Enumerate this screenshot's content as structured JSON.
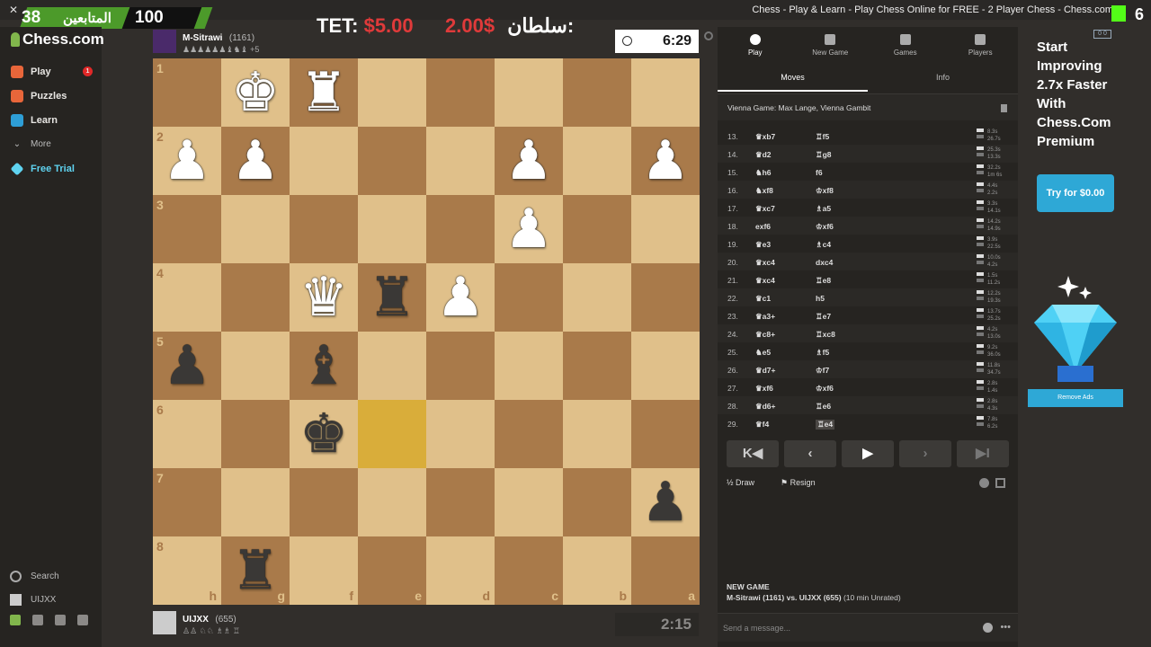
{
  "window": {
    "title": "Chess - Play & Learn - Play Chess Online for FREE - 2 Player Chess - Chess.com"
  },
  "overlay": {
    "count_left": "38",
    "label": "المتابعين",
    "count_right": "100",
    "kick_count": "6",
    "kick_mini": "0 0"
  },
  "donations": {
    "first_name": "TET:",
    "first_amount": "$5.00",
    "second_amount": "2.00$",
    "second_name": "سلطان:"
  },
  "sidebar": {
    "logo": "Chess.com",
    "items": [
      {
        "label": "Play",
        "badge": "1",
        "color": "#e8663a"
      },
      {
        "label": "Puzzles",
        "color": "#e8663a"
      },
      {
        "label": "Learn",
        "color": "#2e9ed6"
      },
      {
        "label": "More"
      },
      {
        "label": "Free Trial",
        "color": "#5fd3f0"
      }
    ],
    "search_label": "Search",
    "user_label": "UIJXX"
  },
  "top_player": {
    "name": "M-Sitrawi",
    "rating": "(1161)",
    "captured": "♟♟♟♟♟♟♝♞♝ +5",
    "clock": "6:29"
  },
  "bottom_player": {
    "name": "UIJXX",
    "rating": "(655)",
    "captured": "♙♙ ♘♘ ♗♗ ♖",
    "clock": "2:15"
  },
  "board": {
    "orientation": "black",
    "ranks": [
      "1",
      "2",
      "3",
      "4",
      "5",
      "6",
      "7",
      "8"
    ],
    "files": [
      "h",
      "g",
      "f",
      "e",
      "d",
      "c",
      "b",
      "a"
    ],
    "highlight": [
      "e6"
    ],
    "pieces": [
      {
        "sq": "g1",
        "type": "K",
        "color": "w"
      },
      {
        "sq": "f1",
        "type": "R",
        "color": "w"
      },
      {
        "sq": "h2",
        "type": "P",
        "color": "w"
      },
      {
        "sq": "g2",
        "type": "P",
        "color": "w"
      },
      {
        "sq": "c2",
        "type": "P",
        "color": "w"
      },
      {
        "sq": "a2",
        "type": "P",
        "color": "w"
      },
      {
        "sq": "c3",
        "type": "P",
        "color": "w"
      },
      {
        "sq": "f4",
        "type": "Q",
        "color": "w"
      },
      {
        "sq": "e4",
        "type": "R",
        "color": "b"
      },
      {
        "sq": "d4",
        "type": "P",
        "color": "w"
      },
      {
        "sq": "h5",
        "type": "P",
        "color": "b"
      },
      {
        "sq": "f5",
        "type": "B",
        "color": "b"
      },
      {
        "sq": "f6",
        "type": "K",
        "color": "b"
      },
      {
        "sq": "a7",
        "type": "P",
        "color": "b"
      },
      {
        "sq": "g8",
        "type": "R",
        "color": "b"
      }
    ]
  },
  "panel": {
    "tabs": [
      "Play",
      "New Game",
      "Games",
      "Players"
    ],
    "subtabs": [
      "Moves",
      "Info"
    ],
    "opening": "Vienna Game: Max Lange, Vienna Gambit",
    "moves": [
      {
        "n": "13.",
        "w": "♛xb7",
        "b": "♖f5",
        "t1": "8.3s",
        "t2": "26.7s"
      },
      {
        "n": "14.",
        "w": "♛d2",
        "b": "♖g8",
        "t1": "25.3s",
        "t2": "13.3s"
      },
      {
        "n": "15.",
        "w": "♞h6",
        "b": "f6",
        "t1": "32.2s",
        "t2": "1m 6s"
      },
      {
        "n": "16.",
        "w": "♞xf8",
        "b": "♔xf8",
        "t1": "4.4s",
        "t2": "2.2s"
      },
      {
        "n": "17.",
        "w": "♛xc7",
        "b": "♗a5",
        "t1": "3.3s",
        "t2": "14.1s"
      },
      {
        "n": "18.",
        "w": "exf6",
        "b": "♔xf6",
        "t1": "14.2s",
        "t2": "14.9s"
      },
      {
        "n": "19.",
        "w": "♛e3",
        "b": "♗c4",
        "t1": "3.9s",
        "t2": "22.5s"
      },
      {
        "n": "20.",
        "w": "♛xc4",
        "b": "dxc4",
        "t1": "10.0s",
        "t2": "4.2s"
      },
      {
        "n": "21.",
        "w": "♛xc4",
        "b": "♖e8",
        "t1": "1.5s",
        "t2": "11.2s"
      },
      {
        "n": "22.",
        "w": "♛c1",
        "b": "h5",
        "t1": "12.2s",
        "t2": "19.3s"
      },
      {
        "n": "23.",
        "w": "♛a3+",
        "b": "♖e7",
        "t1": "13.7s",
        "t2": "25.2s"
      },
      {
        "n": "24.",
        "w": "♛c8+",
        "b": "♖xc8",
        "t1": "4.2s",
        "t2": "13.0s"
      },
      {
        "n": "25.",
        "w": "♞e5",
        "b": "♗f5",
        "t1": "9.2s",
        "t2": "36.0s"
      },
      {
        "n": "26.",
        "w": "♛d7+",
        "b": "♔f7",
        "t1": "11.8s",
        "t2": "34.7s"
      },
      {
        "n": "27.",
        "w": "♛xf6",
        "b": "♔xf6",
        "t1": "2.8s",
        "t2": "1.4s"
      },
      {
        "n": "28.",
        "w": "♛d6+",
        "b": "♖e6",
        "t1": "2.8s",
        "t2": "4.3s"
      },
      {
        "n": "29.",
        "w": "♛f4",
        "b": "♖e4",
        "t1": "7.8s",
        "t2": "6.2s"
      }
    ],
    "controls": [
      "K◀",
      "‹",
      "▶",
      "›",
      "▶I"
    ],
    "draw_label": "½ Draw",
    "resign_label": "⚑ Resign",
    "new_game_title": "NEW GAME",
    "new_game_players": "M-Sitrawi (1161) vs. UIJXX (655)",
    "new_game_mode": "(10 min Unrated)",
    "chat_placeholder": "Send a message..."
  },
  "ad": {
    "headline_lines": [
      "Start",
      "Improving",
      "2.7x Faster",
      "With",
      "Chess.Com",
      "Premium"
    ],
    "button": "Try for $0.00",
    "remove_ads": "Remove Ads"
  }
}
